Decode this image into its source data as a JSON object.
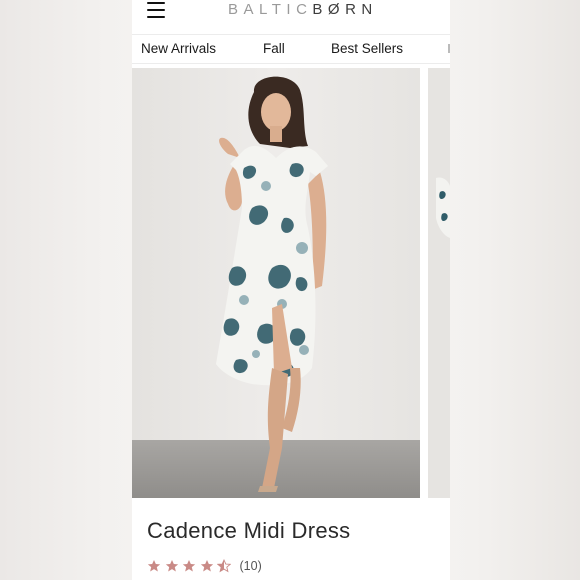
{
  "header": {
    "logo_part1": "BALTIC",
    "logo_part2": "BØRN"
  },
  "nav": {
    "items": [
      {
        "label": "New Arrivals"
      },
      {
        "label": "Fall"
      },
      {
        "label": "Best Sellers"
      }
    ]
  },
  "gallery": {
    "zoom_icon": "magnifier-icon"
  },
  "product": {
    "title": "Cadence Midi Dress",
    "rating": 4.5,
    "review_count": "(10)",
    "star_color": "#c98a86"
  }
}
